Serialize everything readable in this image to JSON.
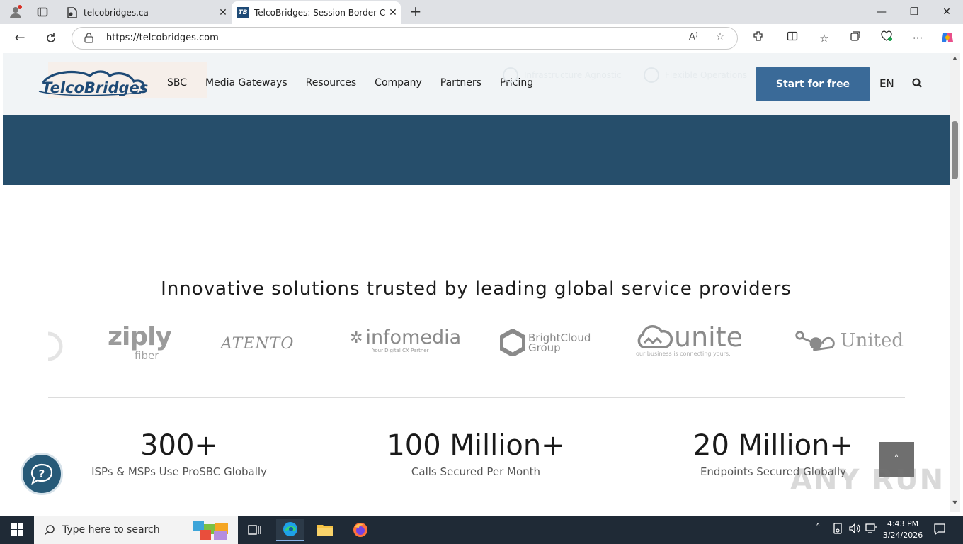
{
  "browser": {
    "tabs": [
      {
        "title": "telcobridges.ca",
        "active": false
      },
      {
        "title": "TelcoBridges: Session Border Cont",
        "active": true
      }
    ],
    "url": "https://telcobridges.com",
    "favicon_text": "TB"
  },
  "site": {
    "logo_text": "TelcoBridges",
    "menu": [
      "SBC",
      "Media Gateways",
      "Resources",
      "Company",
      "Partners",
      "Pricing"
    ],
    "ghost_checks": [
      "Infrastructure Agnostic",
      "Flexible Operations"
    ],
    "cta_label": "Start for free",
    "lang": "EN"
  },
  "trust": {
    "title": "Innovative solutions trusted by leading global service providers",
    "logos": [
      {
        "name": "ziply",
        "sub": "fiber"
      },
      {
        "name": "ATENTO",
        "sub": ""
      },
      {
        "name": "infomedia",
        "sub": "Your Digital CX Partner"
      },
      {
        "name": "BrightCloud",
        "sub": "Group"
      },
      {
        "name": "unite",
        "sub": "our business is connecting yours."
      },
      {
        "name": "United",
        "sub": ""
      }
    ]
  },
  "stats": [
    {
      "value": "300+",
      "label": "ISPs & MSPs Use ProSBC Globally"
    },
    {
      "value": "100 Million+",
      "label": "Calls Secured Per Month"
    },
    {
      "value": "20 Million+",
      "label": "Endpoints Secured Globally"
    }
  ],
  "watermark": "ANY RUN",
  "taskbar": {
    "search_placeholder": "Type here to search",
    "time": "4:43 PM",
    "date": "3/24/2026"
  },
  "colors": {
    "brand": "#264e6b",
    "cta": "#3a6a98",
    "logo_blue": "#1e4a76"
  }
}
